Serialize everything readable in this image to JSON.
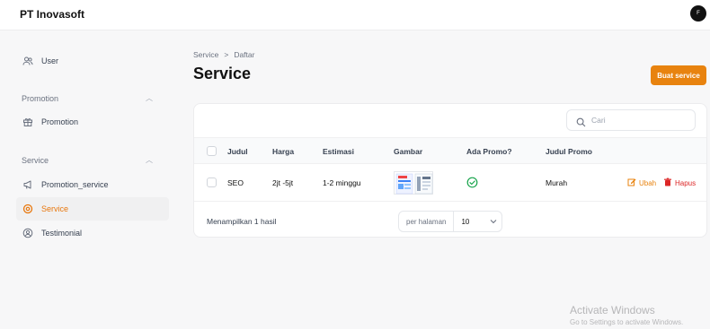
{
  "app": {
    "brand": "PT Inovasoft",
    "avatar_initial": "F"
  },
  "sidebar": {
    "user_item": "User",
    "groups": [
      {
        "label": "Promotion",
        "items": [
          "Promotion"
        ]
      },
      {
        "label": "Service",
        "items": [
          "Promotion_service",
          "Service",
          "Testimonial"
        ]
      }
    ],
    "active_item": "Service"
  },
  "breadcrumb": {
    "parent": "Service",
    "separator": ">",
    "current": "Daftar"
  },
  "page": {
    "title": "Service",
    "create_button": "Buat service"
  },
  "search": {
    "placeholder": "Cari"
  },
  "table": {
    "columns": [
      "Judul",
      "Harga",
      "Estimasi",
      "Gambar",
      "Ada Promo?",
      "Judul Promo"
    ],
    "rows": [
      {
        "judul": "SEO",
        "harga": "2jt -5jt",
        "estimasi": "1-2 minggu",
        "ada_promo": true,
        "judul_promo": "Murah"
      }
    ],
    "edit_label": "Ubah",
    "delete_label": "Hapus"
  },
  "footer": {
    "result_text": "Menampilkan 1 hasil",
    "per_page_label": "per halaman",
    "per_page_value": "10"
  },
  "watermark": {
    "line1": "Activate Windows",
    "line2": "Go to Settings to activate Windows."
  },
  "colors": {
    "accent": "#e8830f",
    "danger": "#dc2626",
    "success": "#16a34a"
  }
}
